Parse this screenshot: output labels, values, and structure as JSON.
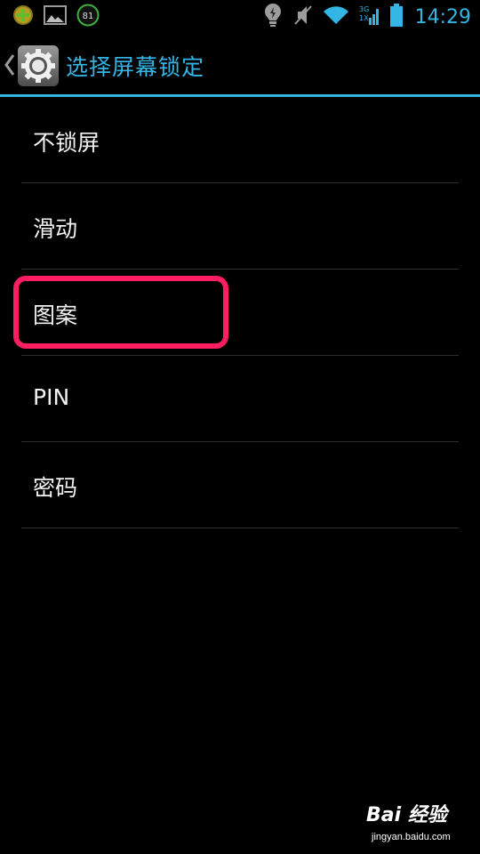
{
  "status_bar": {
    "time": "14:29",
    "notification_badge": "81",
    "network_3g": "3G",
    "network_1x": "1X",
    "icons": [
      "add-app-icon",
      "gallery-icon",
      "badge-81-icon",
      "location-icon",
      "mute-icon",
      "wifi-icon",
      "signal-icon",
      "battery-icon"
    ]
  },
  "action_bar": {
    "title": "选择屏幕锁定",
    "back_icon": "back-chevron-icon",
    "app_icon": "settings-gear-icon"
  },
  "list": {
    "items": [
      {
        "label": "不锁屏"
      },
      {
        "label": "滑动"
      },
      {
        "label": "图案"
      },
      {
        "label": "PIN"
      },
      {
        "label": "密码"
      }
    ]
  },
  "watermark": {
    "logo": "Bai 经验",
    "url": "jingyan.baidu.com"
  },
  "colors": {
    "accent": "#33b5e5",
    "highlight": "#ff1e61",
    "background": "#000000"
  }
}
